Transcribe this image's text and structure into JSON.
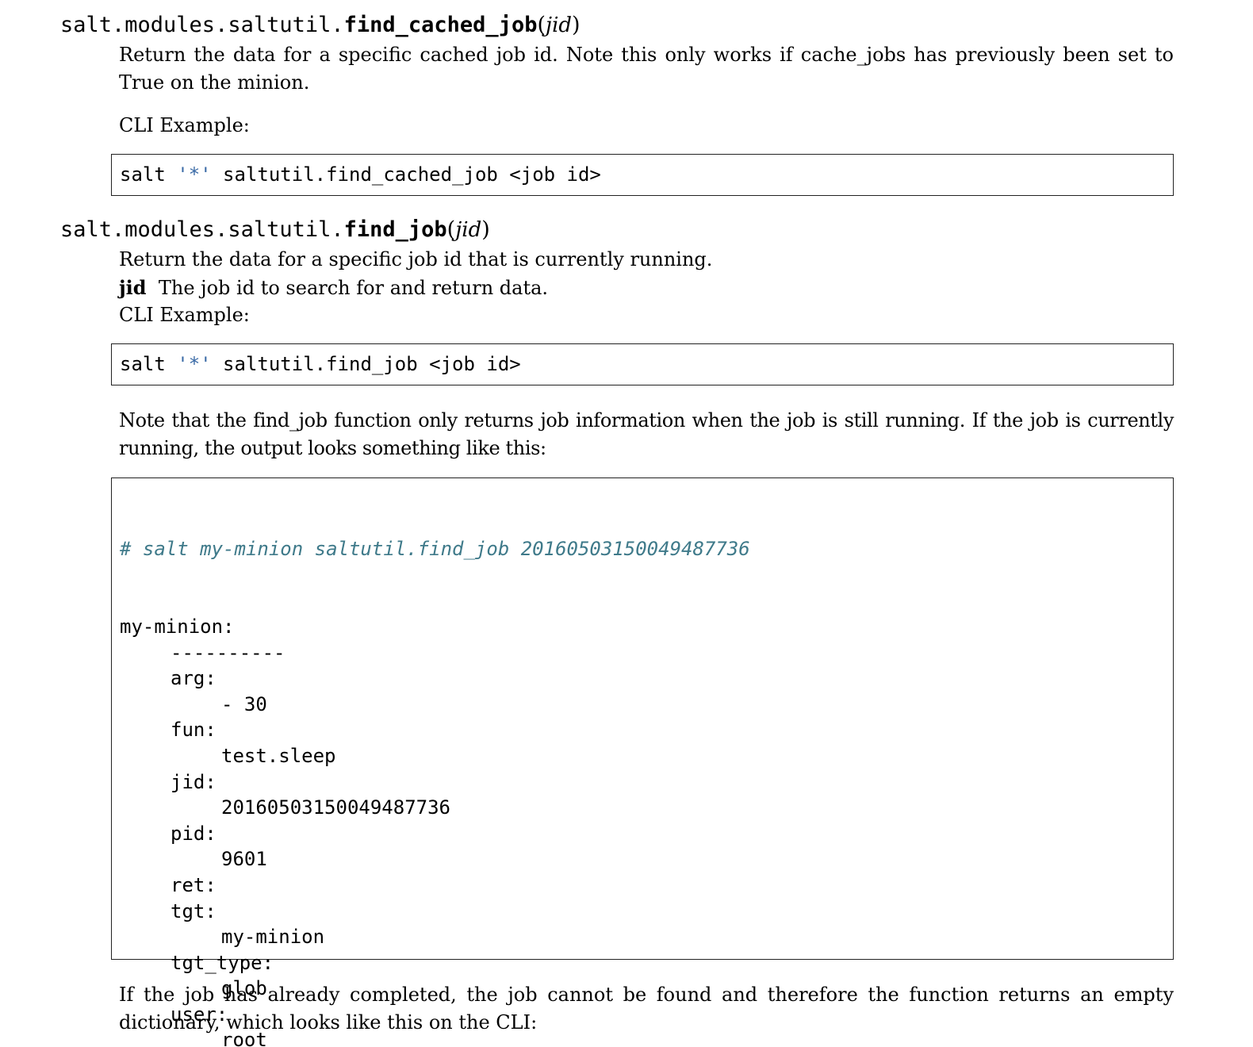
{
  "section1": {
    "sig_prefix": "salt.modules.saltutil.",
    "sig_name": "find_cached_job",
    "sig_param": "jid",
    "desc": "Return the data for a specific cached job id. Note this only works if cache_jobs has previously been set to True on the minion.",
    "cli_label": "CLI Example:",
    "code_prefix": "salt ",
    "code_str": "'*'",
    "code_rest": " saltutil.find_cached_job <job id>"
  },
  "section2": {
    "sig_prefix": "salt.modules.saltutil.",
    "sig_name": "find_job",
    "sig_param": "jid",
    "desc": "Return the data for a specific job id that is currently running.",
    "param_name": "jid",
    "param_desc": "The job id to search for and return data.",
    "cli_label": "CLI Example:",
    "code_prefix": "salt ",
    "code_str": "'*'",
    "code_rest": " saltutil.find_job <job id>",
    "note": "Note that the find_job function only returns job information when the job is still running. If the job is currently running, the output looks something like this:",
    "output_comment": "# salt my-minion saltutil.find_job 20160503150049487736",
    "output_lines": [
      {
        "indent": 0,
        "text": "my-minion:"
      },
      {
        "indent": 1,
        "text": "----------"
      },
      {
        "indent": 1,
        "text": "arg:"
      },
      {
        "indent": 2,
        "text": "- 30"
      },
      {
        "indent": 1,
        "text": "fun:"
      },
      {
        "indent": 2,
        "text": "test.sleep"
      },
      {
        "indent": 1,
        "text": "jid:"
      },
      {
        "indent": 2,
        "text": "20160503150049487736"
      },
      {
        "indent": 1,
        "text": "pid:"
      },
      {
        "indent": 2,
        "text": "9601"
      },
      {
        "indent": 1,
        "text": "ret:"
      },
      {
        "indent": 1,
        "text": "tgt:"
      },
      {
        "indent": 2,
        "text": "my-minion"
      },
      {
        "indent": 1,
        "text": "tgt_type:"
      },
      {
        "indent": 2,
        "text": "glob"
      },
      {
        "indent": 1,
        "text": "user:"
      },
      {
        "indent": 2,
        "text": "root"
      }
    ],
    "footer": "If the job has already completed, the job cannot be found and therefore the function returns an empty dictionary, which looks like this on the CLI:"
  }
}
